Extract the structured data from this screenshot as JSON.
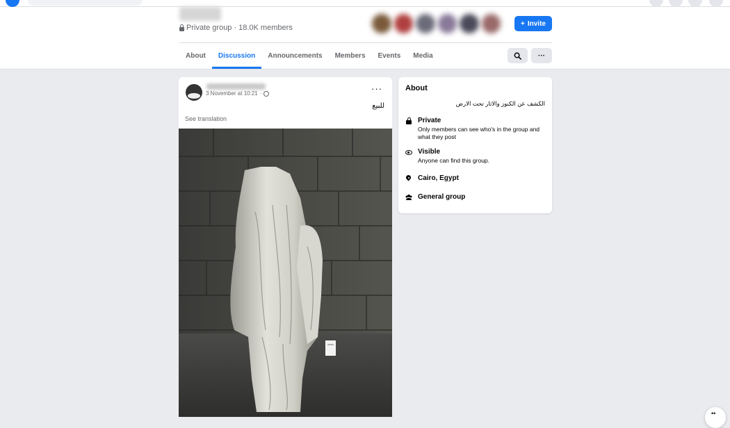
{
  "group": {
    "privacy_label": "Private group",
    "separator": "·",
    "members_label": "18.0K members",
    "invite_label": "Invite",
    "invite_icon": "+"
  },
  "tabs": [
    {
      "label": "About",
      "active": false
    },
    {
      "label": "Discussion",
      "active": true
    },
    {
      "label": "Announcements",
      "active": false
    },
    {
      "label": "Members",
      "active": false
    },
    {
      "label": "Events",
      "active": false
    },
    {
      "label": "Media",
      "active": false
    }
  ],
  "toolbar": {
    "search_icon": "search-icon",
    "more_icon": "more-icon",
    "more_label": "···"
  },
  "post": {
    "timestamp": "3 November at 10:21",
    "dot": "·",
    "more_label": "···",
    "text": "للبيع",
    "see_translation": "See translation"
  },
  "about": {
    "title": "About",
    "description": "الكشف عن الكنوز والاثار تحت الارض",
    "rows": [
      {
        "icon": "lock-icon",
        "title": "Private",
        "subtitle": "Only members can see who's in the group and what they post"
      },
      {
        "icon": "eye-icon",
        "title": "Visible",
        "subtitle": "Anyone can find this group."
      },
      {
        "icon": "location-pin-icon",
        "title": "Cairo, Egypt",
        "subtitle": ""
      },
      {
        "icon": "people-icon",
        "title": "General group",
        "subtitle": ""
      }
    ]
  },
  "colors": {
    "accent": "#1877f2",
    "background": "#e9ebee",
    "card": "#ffffff",
    "secondary_text": "#65676b"
  }
}
